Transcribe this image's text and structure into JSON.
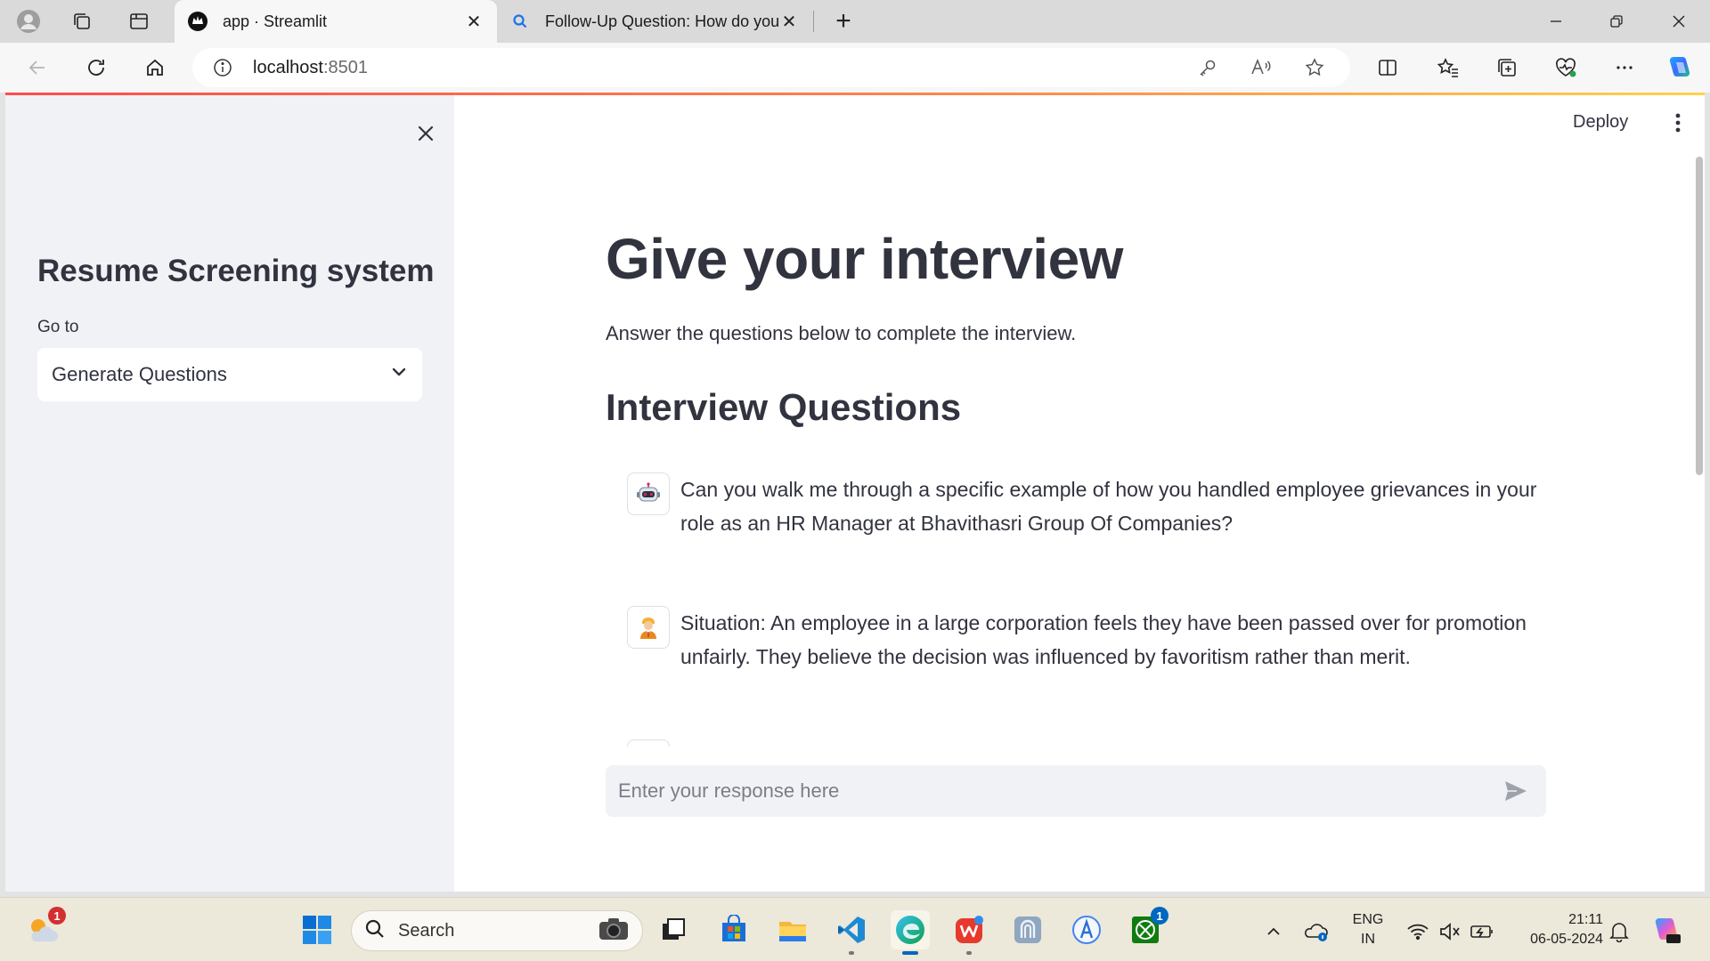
{
  "browser": {
    "tabs": [
      {
        "title": "app · Streamlit",
        "active": true
      },
      {
        "title": "Follow-Up Question: How do you",
        "active": false
      }
    ],
    "new_tab_label": "+",
    "address": {
      "host": "localhost",
      "port": ":8501"
    }
  },
  "app": {
    "sidebar": {
      "title": "Resume Screening system",
      "goto_label": "Go to",
      "selected_page": "Generate Questions"
    },
    "header": {
      "deploy_label": "Deploy"
    },
    "main": {
      "title": "Give your interview",
      "subtitle": "Answer the questions below to complete the interview.",
      "section_title": "Interview Questions",
      "messages": [
        {
          "role": "assistant",
          "avatar": "robot-icon",
          "text": "Can you walk me through a specific example of how you handled employee grievances in your role as an HR Manager at Bhavithasri Group Of Companies?"
        },
        {
          "role": "user",
          "avatar": "user-icon",
          "text": "Situation: An employee in a large corporation feels they have been passed over for promotion unfairly. They believe the decision was influenced by favoritism rather than merit."
        }
      ],
      "chat_input": {
        "placeholder": "Enter your response here"
      }
    }
  },
  "taskbar": {
    "search_label": "Search",
    "weather_badge": "1",
    "xbox_badge": "1",
    "language": {
      "line1": "ENG",
      "line2": "IN"
    },
    "clock": {
      "time": "21:11",
      "date": "06-05-2024"
    }
  },
  "colors": {
    "accent": "#ff4b4b",
    "sidebar_bg": "#f0f2f6",
    "text": "#31333f",
    "taskbar_bg": "#ece8da"
  }
}
